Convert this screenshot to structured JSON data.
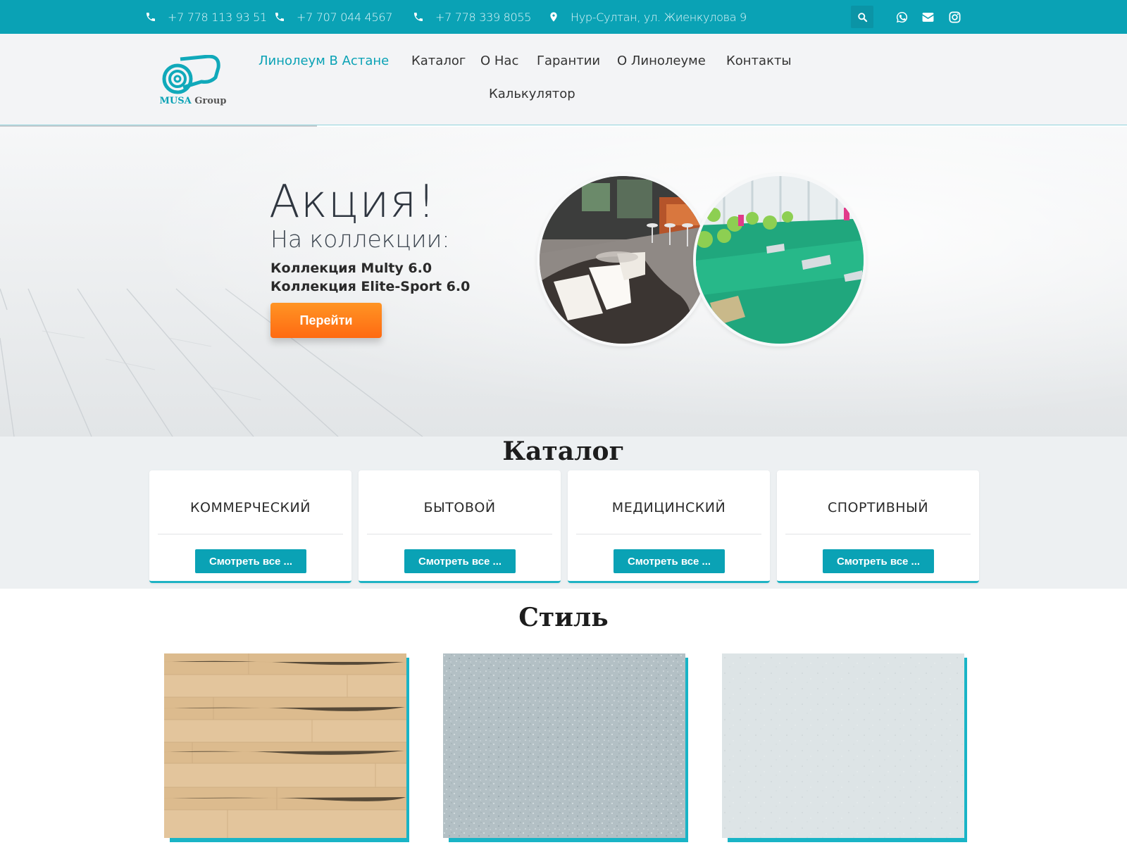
{
  "topbar": {
    "phones": [
      "+7 778 113 93 51",
      "+7 707 044 4567",
      "+7 778 339 8055"
    ],
    "address": "Нур-Султан, ул. Жиенкулова 9",
    "icons": [
      "phone-icon",
      "map-pin-icon",
      "search-icon",
      "whatsapp-icon",
      "mail-icon",
      "instagram-icon"
    ]
  },
  "logo": {
    "brand": "MUSA",
    "suffix": "Group"
  },
  "nav": {
    "items": [
      "Линолеум В Астане",
      "Каталог",
      "О Нас",
      "Гарантии",
      "О Линолеуме",
      "Контакты",
      "Калькулятор"
    ],
    "active_index": 0
  },
  "hero": {
    "title": "Акция!",
    "subtitle": "На коллекции:",
    "lines": [
      "Коллекция Multy 6.0",
      "Коллекция Elite-Sport 6.0"
    ],
    "button": "Перейти"
  },
  "catalog": {
    "title": "Каталог",
    "cards": [
      {
        "name": "КОММЕРЧЕСКИЙ",
        "button": "Смотреть все ..."
      },
      {
        "name": "БЫТОВОЙ",
        "button": "Смотреть все ..."
      },
      {
        "name": "МЕДИЦИНСКИЙ",
        "button": "Смотреть все ..."
      },
      {
        "name": "СПОРТИВНЫЙ",
        "button": "Смотреть все ..."
      }
    ]
  },
  "style": {
    "title": "Стиль",
    "tiles": [
      "wood-texture",
      "grey-speckle-texture",
      "light-grey-texture"
    ]
  },
  "colors": {
    "accent": "#0aa2b5",
    "orange": "#ff7a18",
    "header_bg": "#f3f4f6",
    "catalog_bg": "#edf0f2"
  }
}
